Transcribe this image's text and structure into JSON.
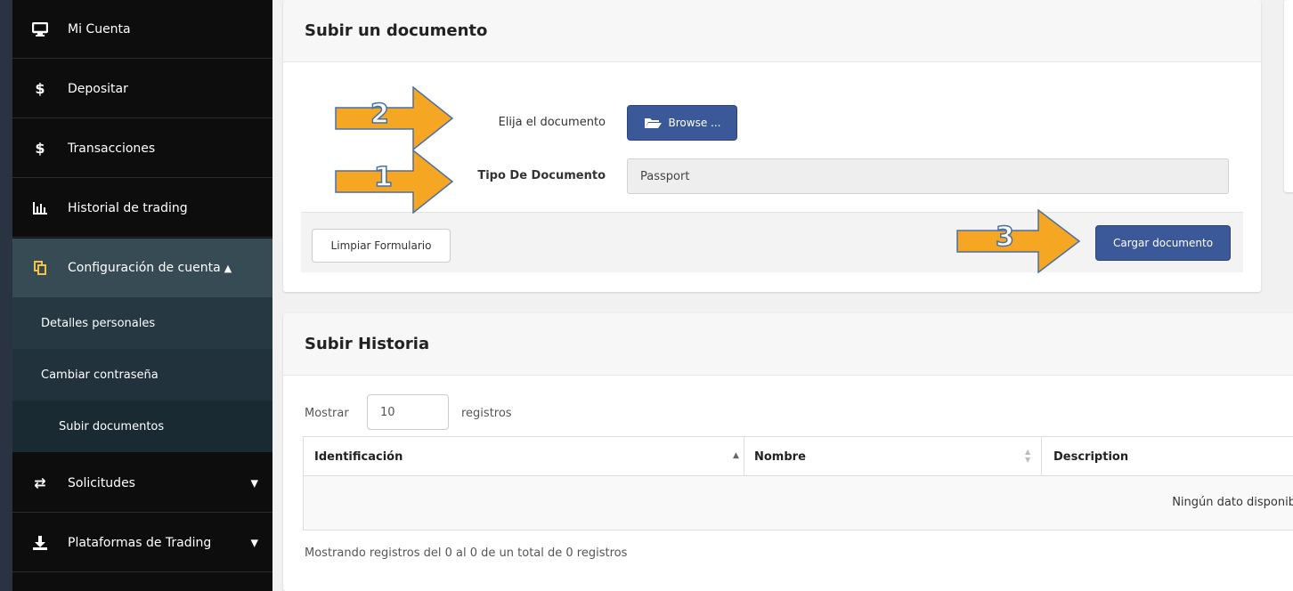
{
  "sidebar": {
    "items": [
      {
        "label": "Mi Cuenta",
        "icon": "monitor-icon"
      },
      {
        "label": "Depositar",
        "icon": "dollar-icon"
      },
      {
        "label": "Transacciones",
        "icon": "dollar-icon"
      },
      {
        "label": "Historial de trading",
        "icon": "bar-chart-icon"
      },
      {
        "label": "Configuración de cuenta",
        "icon": "copy-icon",
        "expanded": true
      },
      {
        "label": "Solicitudes",
        "icon": "exchange-icon"
      },
      {
        "label": "Plataformas de Trading",
        "icon": "download-icon"
      }
    ],
    "subitems": [
      {
        "label": "Detalles personales"
      },
      {
        "label": "Cambiar contraseña"
      },
      {
        "label": "Subir documentos",
        "current": true
      }
    ]
  },
  "upload": {
    "title": "Subir un documento",
    "choose_label": "Elija el documento",
    "browse_label": "Browse ...",
    "type_label": "Tipo De Documento",
    "type_value": "Passport",
    "clear_label": "Limpiar Formulario",
    "submit_label": "Cargar documento"
  },
  "annotations": {
    "arrow_1": "1",
    "arrow_2": "2",
    "arrow_3": "3",
    "color": "#f5a623"
  },
  "history": {
    "title": "Subir Historia",
    "show_label": "Mostrar",
    "page_size": "10",
    "records_label": "registros",
    "columns": [
      "Identificación",
      "Nombre",
      "Description"
    ],
    "empty_text": "Ningún dato disponib",
    "info_text": "Mostrando registros del 0 al 0 de un total de 0 registros"
  },
  "colors": {
    "primary": "#3b5998",
    "sidebar_bg": "#0d0d0d",
    "sidebar_active": "#374b55",
    "frame_bg": "#2a3341"
  }
}
